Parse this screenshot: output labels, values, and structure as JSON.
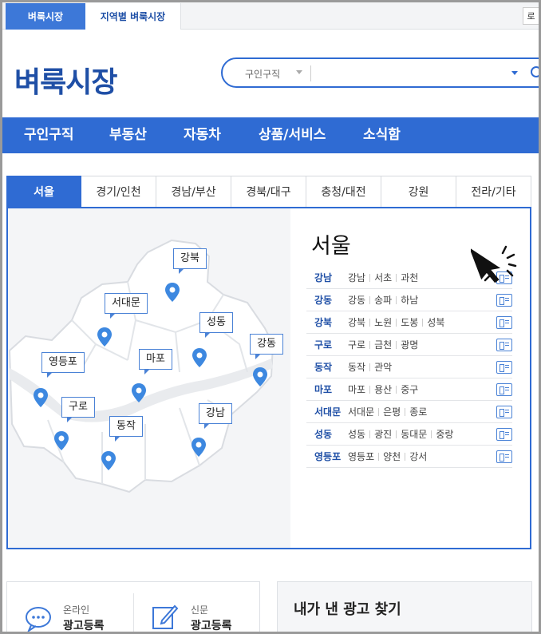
{
  "top_tabs": [
    "벼룩시장",
    "지역별 벼룩시장"
  ],
  "login_label": "로",
  "logo": "벼룩시장",
  "search": {
    "category": "구인구직"
  },
  "nav": [
    "구인구직",
    "부동산",
    "자동차",
    "상품/서비스",
    "소식함"
  ],
  "region_tabs": [
    "서울",
    "경기/인천",
    "경남/부산",
    "경북/대구",
    "충청/대전",
    "강원",
    "전라/기타"
  ],
  "map_labels": [
    "강북",
    "서대문",
    "성동",
    "강동",
    "영등포",
    "마포",
    "구로",
    "동작",
    "강남"
  ],
  "side": {
    "title": "서울",
    "rows": [
      {
        "key": "강남",
        "subs": [
          "강남",
          "서초",
          "과천"
        ]
      },
      {
        "key": "강동",
        "subs": [
          "강동",
          "송파",
          "하남"
        ]
      },
      {
        "key": "강북",
        "subs": [
          "강북",
          "노원",
          "도봉",
          "성북"
        ]
      },
      {
        "key": "구로",
        "subs": [
          "구로",
          "금천",
          "광명"
        ]
      },
      {
        "key": "동작",
        "subs": [
          "동작",
          "관악"
        ]
      },
      {
        "key": "마포",
        "subs": [
          "마포",
          "용산",
          "중구"
        ]
      },
      {
        "key": "서대문",
        "subs": [
          "서대문",
          "은평",
          "종로"
        ]
      },
      {
        "key": "성동",
        "subs": [
          "성동",
          "광진",
          "동대문",
          "중랑"
        ]
      },
      {
        "key": "영등포",
        "subs": [
          "영등포",
          "양천",
          "강서"
        ]
      }
    ]
  },
  "bottom": {
    "online": {
      "small": "온라인",
      "big": "광고등록"
    },
    "paper": {
      "small": "신문",
      "big": "광고등록"
    },
    "find_title": "내가 낸 광고 찾기"
  },
  "colors": {
    "brand": "#2f6bd3",
    "logo": "#1f4fa6"
  }
}
